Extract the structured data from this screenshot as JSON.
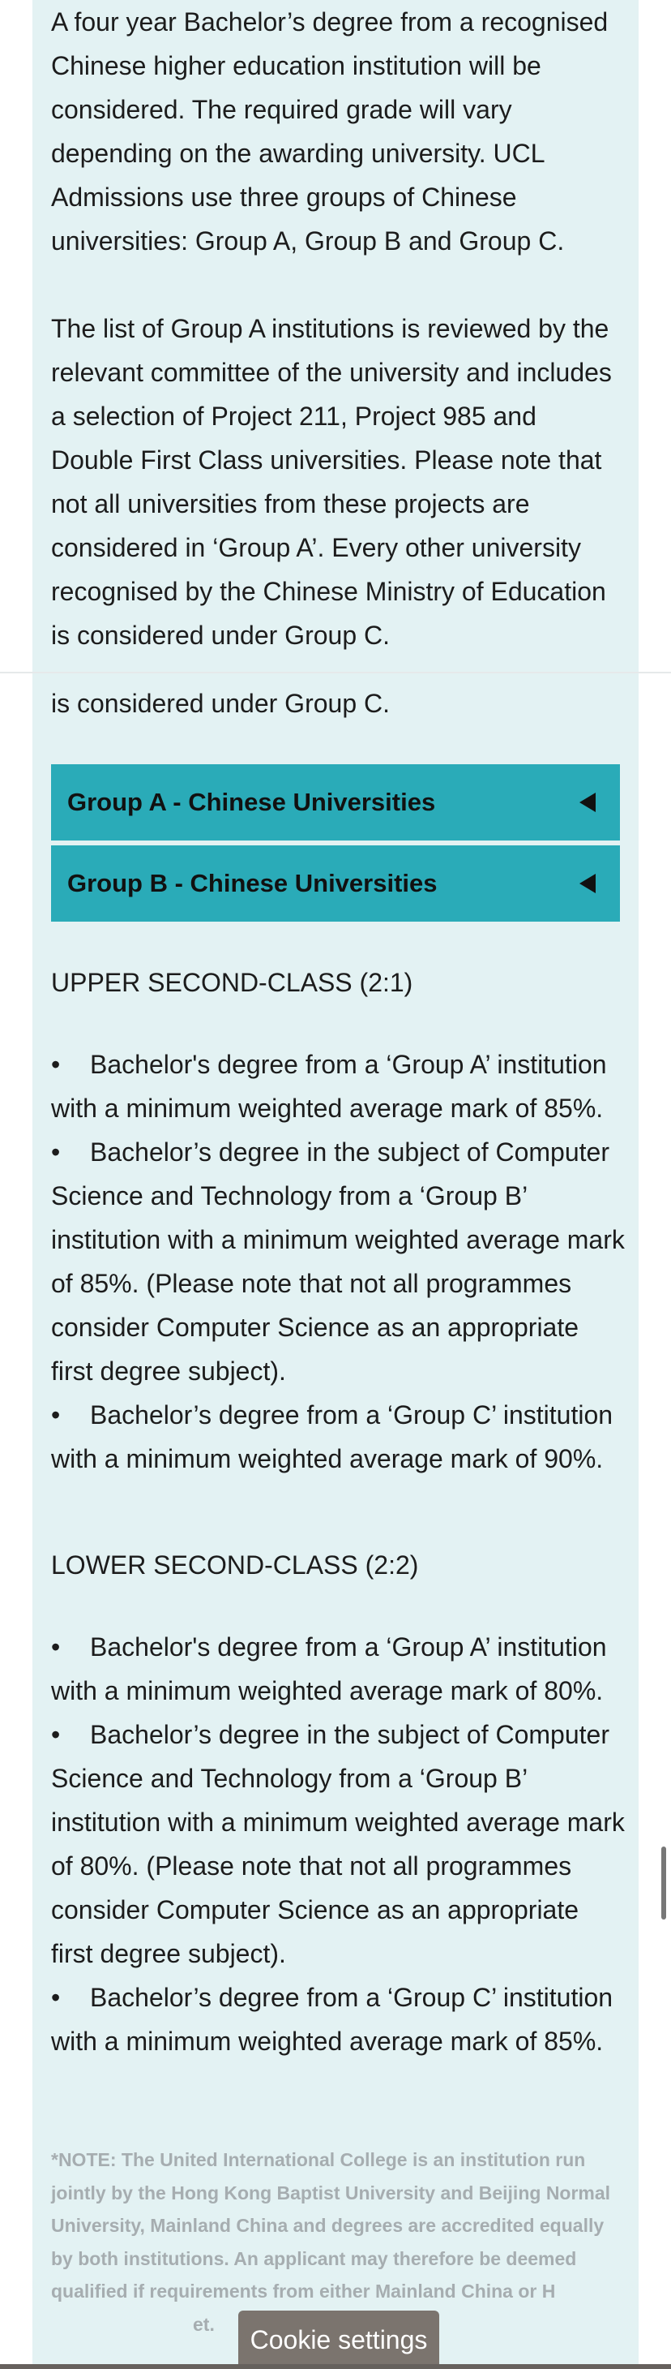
{
  "intro": {
    "paragraph1": "A four year Bachelor’s degree from a recognised Chinese higher education institution will be considered. The required grade will vary depending on the awarding university. UCL Admissions use three groups of Chinese universities: Group A, Group B and Group C.",
    "paragraph2": "The list of Group A institutions is reviewed by the relevant committee of the university and includes a selection of Project 211, Project 985 and Double First Class universities. Please note that not all universities from these projects are considered in ‘Group A’. Every other university recognised by the Chinese Ministry of Education is considered under Group C.",
    "repeated_line": "is considered under Group C."
  },
  "accordions": [
    {
      "label": "Group A - Chinese Universities"
    },
    {
      "label": "Group B - Chinese Universities"
    }
  ],
  "upper": {
    "heading": "UPPER SECOND-CLASS (2:1)",
    "items": [
      "Bachelor's degree from a ‘Group A’ institution with a minimum weighted average mark of 85%.",
      "Bachelor’s degree in the subject of Computer Science and Technology from a ‘Group B’ institution with a minimum weighted average mark of 85%. (Please note that not all programmes consider Computer Science as an appropriate first degree subject).",
      "Bachelor’s degree from a ‘Group C’ institution with a minimum weighted average mark of 90%."
    ]
  },
  "lower": {
    "heading": "LOWER SECOND-CLASS (2:2)",
    "items": [
      "Bachelor's degree from a ‘Group A’ institution with a minimum weighted average mark of 80%.",
      "Bachelor’s degree in the subject of Computer Science and Technology from a ‘Group B’ institution with a minimum weighted average mark of 80%. (Please note that not all programmes consider Computer Science as an appropriate first degree subject).",
      "Bachelor’s degree from a ‘Group C’ institution with a minimum weighted average mark of 85%."
    ]
  },
  "bullet_symbol": "•",
  "note": "*NOTE: The United International College is an institution run jointly by the Hong Kong Baptist University and Beijing Normal University, Mainland China and degrees are accredited equally by both institutions. An applicant may therefore be deemed qualified if requirements from either Mainland China or H",
  "note_tail": "et.",
  "cookie_button": "Cookie settings"
}
